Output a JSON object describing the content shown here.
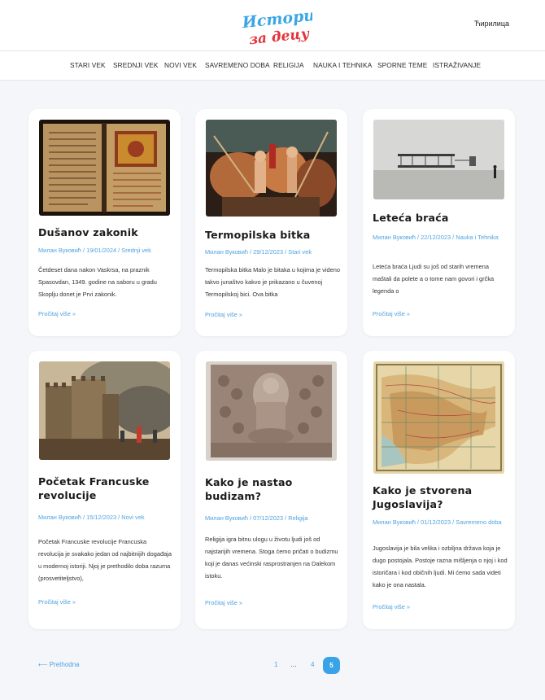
{
  "header": {
    "logo_line1": "Историја",
    "logo_line2": "за децу",
    "lang_switch": "Ћирилица"
  },
  "nav": {
    "items": [
      "STARI VEK",
      "SREDNJI VEK",
      "NOVI VEK",
      "SAVREMENO DOBA",
      "RELIGIJA",
      "NAUKA I TEHNIKA",
      "SPORNE TEME",
      "ISTRAŽIVANJE"
    ]
  },
  "posts": [
    {
      "title": "Dušanov zakonik",
      "meta": "Милан Вуковић / 19/01/2024 / Srednji vek",
      "excerpt": "Četdeset dana nakon Vaskrsa, na praznik Spasovdan, 1349. godine na saboru u gradu Skoplju donet je Prvi zakonik.",
      "read_more": "Pročitaj više »",
      "image": "manuscript-book-image"
    },
    {
      "title": "Termopilska bitka",
      "meta": "Милан Вуковић / 29/12/2023 / Stari vek",
      "excerpt": "Termopilska bitka Malo je bitaka u kojima je videno takvo junaštvo kakvo je prikazano u čuvenoj Termopilskoj bici. Ova bitka",
      "read_more": "Pročitaj više »",
      "image": "battle-painting-image"
    },
    {
      "title": "Leteća braća",
      "meta": "Милан Вуковић / 22/12/2023 / Nauka i Tehnika",
      "excerpt": "Leteća braća Ljudi su još od starih vremena maštali da polete a o tome nam govori i grčka legenda o",
      "read_more": "Pročitaj više »",
      "image": "wright-flyer-photo"
    },
    {
      "title": "Početak Francuske revolucije",
      "meta": "Милан Вуковић / 15/12/2023 / Novi vek",
      "excerpt": "Početak Francuske revolucije Francuska revolucija je svakako jedan od najbitnijih događaja u modernoj istoriji. Njoj je prethodilo doba razuma (prosvetiteljstvo),",
      "read_more": "Pročitaj više »",
      "image": "bastille-painting-image"
    },
    {
      "title": "Kako je nastao budizam?",
      "meta": "Милан Вуковић / 07/12/2023 / Religija",
      "excerpt": "Religija igra bitnu ulogu u životu ljudi još od najstarijih vremena. Stoga ćemo pričati o budizmu koji je danas većinski rasprostranjen na Dalekom istoku.",
      "read_more": "Pročitaj više »",
      "image": "buddha-relief-image"
    },
    {
      "title": "Kako je stvorena Jugoslavija?",
      "meta": "Милан Вуковић / 01/12/2023 / Savremeno doba",
      "excerpt": "Jugoslavija je bila velika i ozbiljna država koja je dugo postojala. Postoje razna mišljenja o njoj i kod istoričara i kod običnih ljudi. Mi ćemo sada videti kako je ona nastala.",
      "read_more": "Pročitaj više »",
      "image": "old-map-image"
    }
  ],
  "pagination": {
    "prev": "⟵ Prethodna",
    "pages": [
      "1",
      "…",
      "4"
    ],
    "current": "5"
  },
  "colors": {
    "accent": "#39a3e8",
    "link": "#4fa3e0",
    "logo_blue": "#3aa6e6",
    "logo_red": "#e5323a",
    "background": "#f4f6f9"
  }
}
